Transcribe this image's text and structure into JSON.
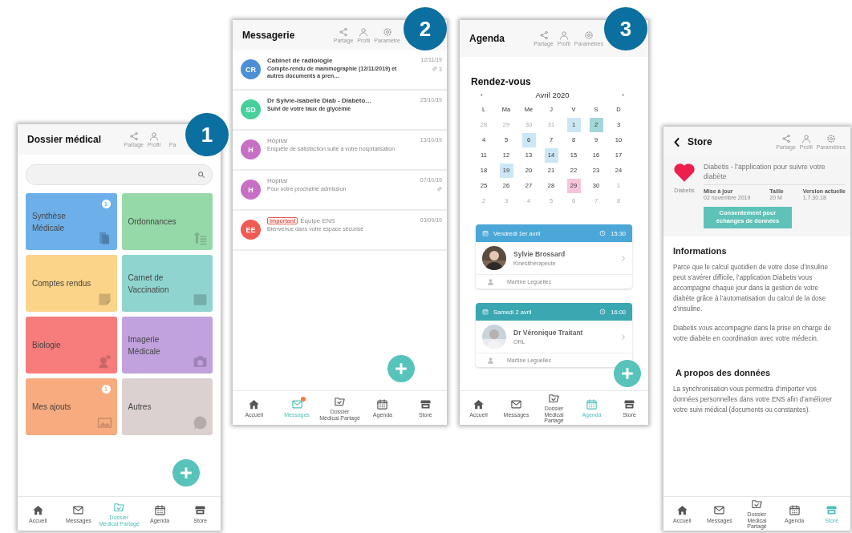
{
  "screens": [
    {
      "kind": "dossier",
      "number": "1",
      "title": "Dossier médical",
      "actions": [
        "Partage",
        "Profil",
        "Pa"
      ],
      "tiles": [
        {
          "label": "Synthèse Médicale",
          "color": "#6db0e9",
          "count": "1"
        },
        {
          "label": "Ordonnances",
          "color": "#96d9a9"
        },
        {
          "label": "Comptes rendus",
          "color": "#fbd489"
        },
        {
          "label": "Carnet de Vaccination",
          "color": "#90d4cf"
        },
        {
          "label": "Biologie",
          "color": "#f77c7c"
        },
        {
          "label": "Imagerie Médicale",
          "color": "#c1a1de"
        },
        {
          "label": "Mes ajouts",
          "color": "#f7ab7e",
          "count": "1"
        },
        {
          "label": "Autres",
          "color": "#dcd1d1"
        }
      ],
      "nav": [
        {
          "label": "Accueil",
          "selected": false,
          "notification": false
        },
        {
          "label": "Messages",
          "selected": false,
          "notification": false
        },
        {
          "label": "Dossier\nMédical Partagé",
          "selected": true,
          "notification": false
        },
        {
          "label": "Agenda",
          "selected": false,
          "notification": false
        },
        {
          "label": "Store",
          "selected": false,
          "notification": false
        }
      ]
    },
    {
      "kind": "messages",
      "number": "2",
      "title": "Messagerie",
      "actions": [
        "Partage",
        "Profil",
        "Paramètre"
      ],
      "messages": [
        {
          "initials": "CR",
          "color": "#4c8fd6",
          "sender": "Cabinet de radiologie",
          "unread": true,
          "subject": "Compte-rendu de mammographie (12/11/2019) et autres documents à pren…",
          "date": "12/11/19",
          "attachment": true,
          "attachment_count": "3"
        },
        {
          "initials": "SD",
          "color": "#47d09b",
          "sender": "Dr Sylvie-Isabelle Diab - Diabéto…",
          "unread": true,
          "subject": "Suivi de votre taux de glycémie",
          "date": "25/10/19",
          "attachment": false
        },
        {
          "initials": "H",
          "color": "#c76fc4",
          "sender": "Hôpital",
          "unread": false,
          "subject": "Enquête de satisfaction suite à votre hospitalisation",
          "date": "13/10/19",
          "attachment": false
        },
        {
          "initials": "H",
          "color": "#c76fc4",
          "sender": "Hôpital",
          "unread": false,
          "subject": "Pour votre prochaine admission",
          "date": "07/10/19",
          "attachment": true
        },
        {
          "initials": "EE",
          "color": "#ee5b55",
          "sender": "Équipe ENS",
          "tag": "Important",
          "unread": false,
          "subject": "Bienvenue dans votre espace sécurisé",
          "date": "03/09/19",
          "attachment": false
        }
      ],
      "nav": [
        {
          "label": "Accueil",
          "selected": false,
          "notification": false
        },
        {
          "label": "Messages",
          "selected": true,
          "notification": true
        },
        {
          "label": "Dossier\nMédical Partagé",
          "selected": false,
          "notification": false
        },
        {
          "label": "Agenda",
          "selected": false,
          "notification": false
        },
        {
          "label": "Store",
          "selected": false,
          "notification": false
        }
      ]
    },
    {
      "kind": "agenda",
      "number": "3",
      "title": "Agenda",
      "actions": [
        "Partage",
        "Profil",
        "Paramètres"
      ],
      "heading": "Rendez-vous",
      "month": "Avril 2020",
      "prev": "‹",
      "next": "›",
      "weekdays": [
        "L",
        "Ma",
        "Me",
        "J",
        "V",
        "S",
        "D"
      ],
      "days": [
        {
          "day": "28",
          "muted": true
        },
        {
          "day": "29",
          "muted": true
        },
        {
          "day": "30",
          "muted": true
        },
        {
          "day": "31",
          "muted": true
        },
        {
          "day": "1",
          "muted": false,
          "color": "#cbe7f5"
        },
        {
          "day": "2",
          "muted": false,
          "color": "#a3d6d8"
        },
        {
          "day": "3",
          "muted": false
        },
        {
          "day": "4",
          "muted": false
        },
        {
          "day": "5",
          "muted": false
        },
        {
          "day": "6",
          "muted": false,
          "color": "#cbe7f5"
        },
        {
          "day": "7",
          "muted": false
        },
        {
          "day": "8",
          "muted": false
        },
        {
          "day": "9",
          "muted": false
        },
        {
          "day": "10",
          "muted": false
        },
        {
          "day": "11",
          "muted": false
        },
        {
          "day": "12",
          "muted": false
        },
        {
          "day": "13",
          "muted": false
        },
        {
          "day": "14",
          "muted": false,
          "color": "#cbe7f5"
        },
        {
          "day": "15",
          "muted": false
        },
        {
          "day": "16",
          "muted": false
        },
        {
          "day": "17",
          "muted": false
        },
        {
          "day": "18",
          "muted": false
        },
        {
          "day": "19",
          "muted": false,
          "color": "#cbe7f5"
        },
        {
          "day": "20",
          "muted": false
        },
        {
          "day": "21",
          "muted": false
        },
        {
          "day": "22",
          "muted": false
        },
        {
          "day": "23",
          "muted": false
        },
        {
          "day": "24",
          "muted": false
        },
        {
          "day": "25",
          "muted": false
        },
        {
          "day": "26",
          "muted": false
        },
        {
          "day": "27",
          "muted": false
        },
        {
          "day": "28",
          "muted": false
        },
        {
          "day": "29",
          "muted": false,
          "color": "#f5c6da"
        },
        {
          "day": "30",
          "muted": false
        },
        {
          "day": "1",
          "muted": true
        },
        {
          "day": "2",
          "muted": true
        },
        {
          "day": "3",
          "muted": true
        },
        {
          "day": "4",
          "muted": true
        },
        {
          "day": "5",
          "muted": true
        },
        {
          "day": "6",
          "muted": true
        },
        {
          "day": "7",
          "muted": true
        },
        {
          "day": "8",
          "muted": true
        }
      ],
      "appointments": [
        {
          "date": "Vendredi 1er avril",
          "time": "15:30",
          "color": "#4aa7d8",
          "name": "Sylvie Brossard",
          "role": "Kinésithérapeute",
          "patient": "Martine Leguellec"
        },
        {
          "date": "Samedi 2 avril",
          "time": "16:00",
          "color": "#3aa7b1",
          "name": "Dr Véronique Traitant",
          "role": "ORL",
          "patient": "Martine Leguellec"
        }
      ],
      "nav": [
        {
          "label": "Accueil",
          "selected": false,
          "notification": false
        },
        {
          "label": "Messages",
          "selected": false,
          "notification": false
        },
        {
          "label": "Dossier\nMédical Partagé",
          "selected": false,
          "notification": false
        },
        {
          "label": "Agenda",
          "selected": true,
          "notification": false
        },
        {
          "label": "Store",
          "selected": false,
          "notification": false
        }
      ]
    },
    {
      "kind": "store",
      "title": "Store",
      "actions": [
        "Partage",
        "Profil",
        "Paramètres"
      ],
      "app": {
        "name": "Diabetis",
        "title": "Diabetis - l’application pour suivre votre diabète",
        "meta": [
          {
            "label": "Mise à jour",
            "value": "02 novembre 2019"
          },
          {
            "label": "Taille",
            "value": "20 M"
          },
          {
            "label": "Version actuelle",
            "value": "1.7.30.18"
          }
        ],
        "button": "Consentement pour échanges de données"
      },
      "sections": [
        {
          "title": "Informations",
          "paragraphs": [
            "Parce que le calcul quotidien de votre dose d’insuline peut s’avérer difficile, l’application Diabetis vous accompagne chaque jour dans la gestion de votre diabète grâce à l’automatisation du calcul de la dose d’insuline.",
            "Diabetis vous accompagne dans la prise en charge de votre diabète en coordination avec votre médecin."
          ]
        },
        {
          "title": "A propos des données",
          "paragraphs": [
            "La synchronisation vous permettra d’importer vos données personnelles dans votre ENS afin d’améliorer votre suivi médical (documents ou constantes)."
          ]
        }
      ],
      "nav": [
        {
          "label": "Accueil",
          "selected": false,
          "notification": false
        },
        {
          "label": "Messages",
          "selected": false,
          "notification": false
        },
        {
          "label": "Dossier\nMédical Partagé",
          "selected": false,
          "notification": false
        },
        {
          "label": "Agenda",
          "selected": false,
          "notification": false
        },
        {
          "label": "Store",
          "selected": true,
          "notification": false
        }
      ]
    }
  ]
}
